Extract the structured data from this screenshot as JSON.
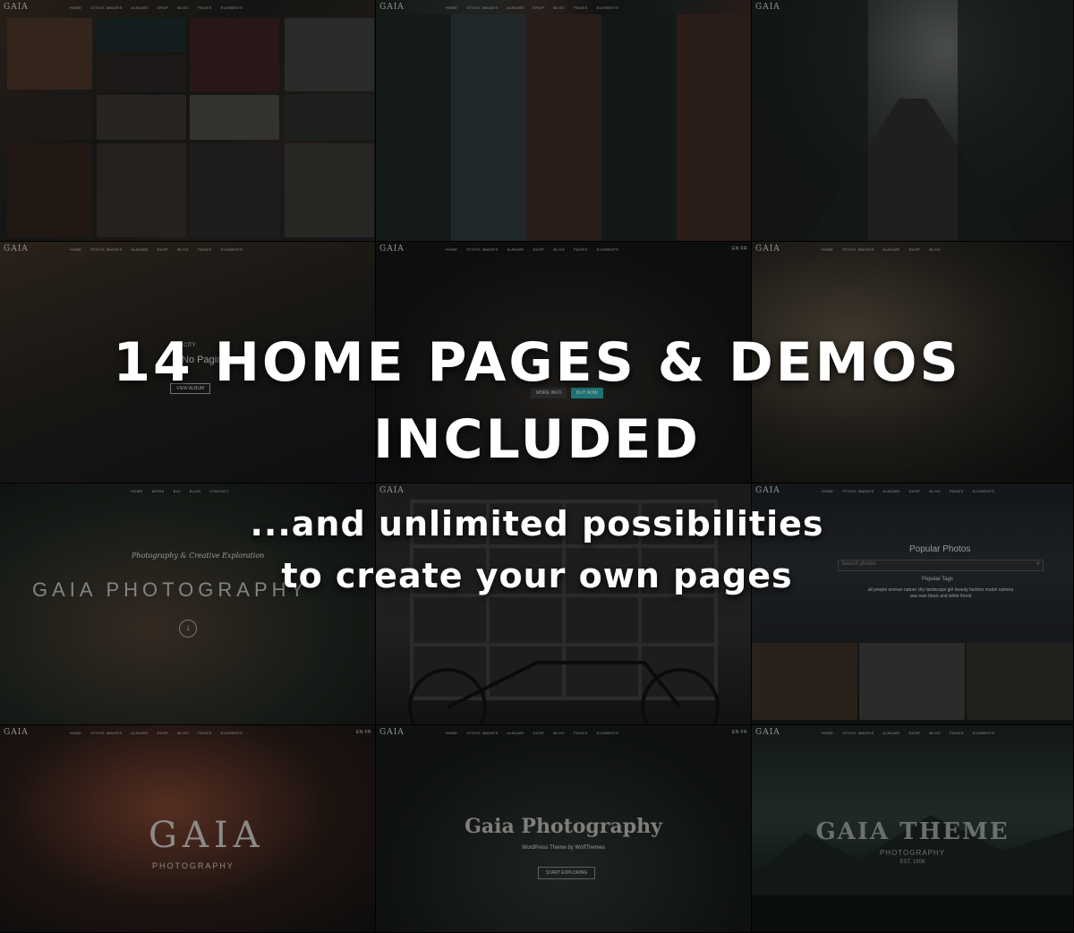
{
  "headline": {
    "line1": "14 HOME PAGES & DEMOS",
    "line2": "INCLUDED"
  },
  "subline": {
    "line1": "...and unlimited possibilities",
    "line2": "to create your own pages"
  },
  "demo_nav": {
    "logo": "GAIA",
    "items": [
      "HOME",
      "STOCK IMAGES",
      "ALBUMS",
      "SHOP",
      "BLOG",
      "PAGES",
      "ELEMENTS"
    ],
    "lang": "EN FR"
  },
  "demo_nav_alt": {
    "items": [
      "HOME",
      "WORK",
      "BIO",
      "BLOG",
      "CONTACT"
    ]
  },
  "tiles": {
    "gaia_photography_script": "Photography & Creative Exploration",
    "gaia_photography_title": "GAIA PHOTOGRAPHY",
    "popular_photos": "Popular Photos",
    "search_placeholder": "Search photos",
    "popular_tags_label": "Popular Tags",
    "popular_tags": "all  people  woman  nature  city  landscape  girl  beauty  fashion  model  camera  sea  man  black and white  forest",
    "gaia_logo_big": "GAIA",
    "gaia_logo_sub": "PHOTOGRAPHY",
    "gaia_photography_serif": "Gaia Photography",
    "gaia_photography_tagline": "WordPress Theme by WolfThemes",
    "start_exploring": "START EXPLORING",
    "gaia_theme": "GAIA THEME",
    "gaia_theme_sub": "PHOTOGRAPHY",
    "gaia_theme_est": "EST. 1908",
    "city_label": "CITY",
    "no_paging": "No Paging",
    "view_album": "VIEW ALBUM",
    "more_info": "MORE INFO",
    "buy_now": "BUY NOW"
  },
  "colors": {
    "overlay_text": "#ffffff",
    "accent_teal": "#2aa7a6"
  }
}
